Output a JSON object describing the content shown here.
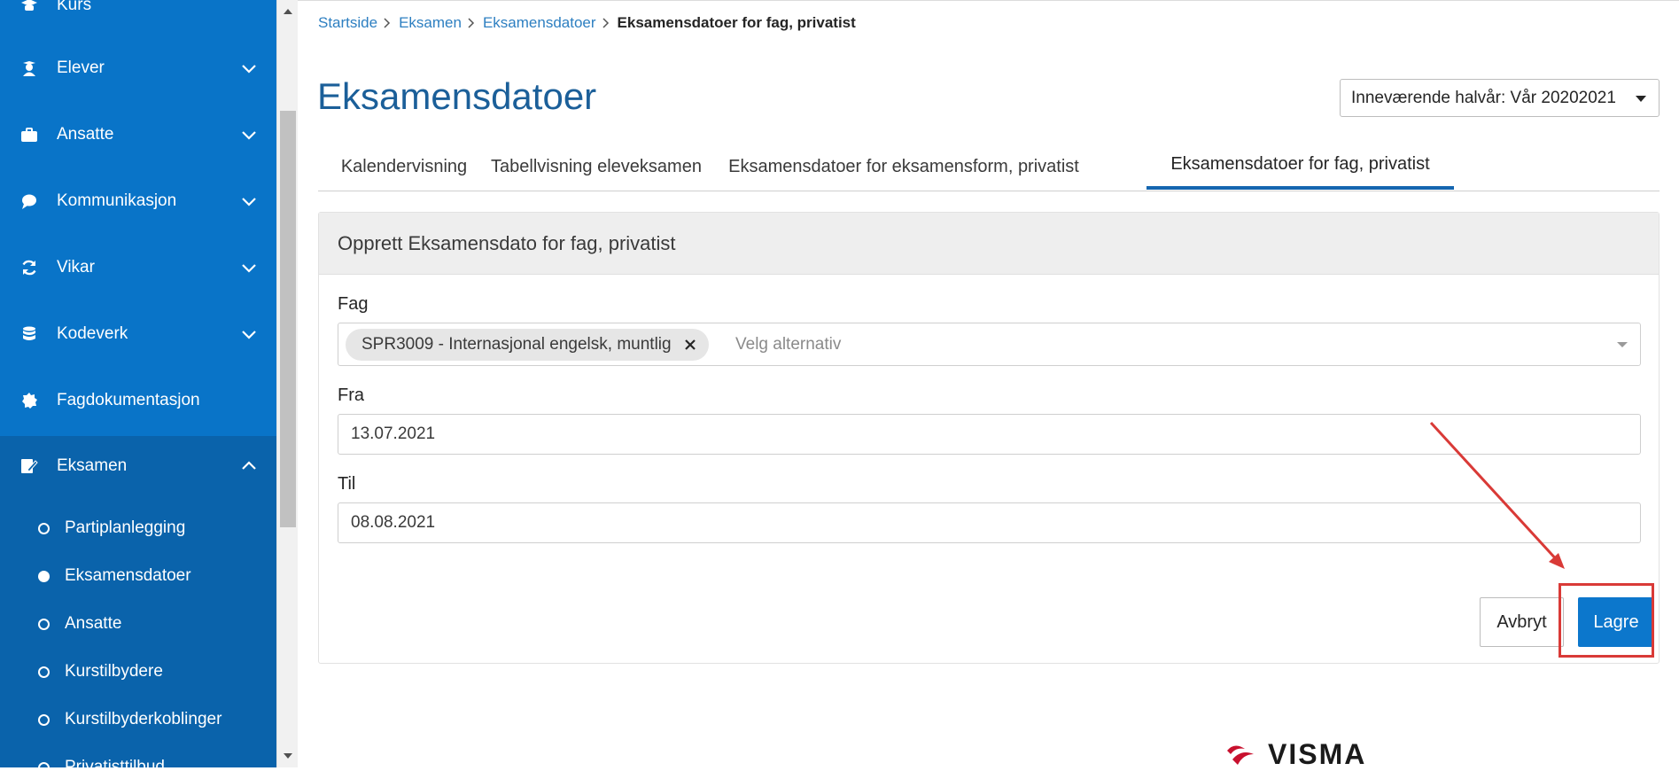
{
  "sidebar": {
    "items": [
      {
        "label": "Kurs",
        "icon": "graduation-cap-icon"
      },
      {
        "label": "Elever",
        "icon": "student-icon"
      },
      {
        "label": "Ansatte",
        "icon": "briefcase-icon"
      },
      {
        "label": "Kommunikasjon",
        "icon": "speech-bubble-icon"
      },
      {
        "label": "Vikar",
        "icon": "refresh-icon"
      },
      {
        "label": "Kodeverk",
        "icon": "database-icon"
      },
      {
        "label": "Fagdokumentasjon",
        "icon": "seal-icon"
      },
      {
        "label": "Eksamen",
        "icon": "edit-document-icon"
      }
    ],
    "subitems": [
      {
        "label": "Partiplanlegging",
        "active": false
      },
      {
        "label": "Eksamensdatoer",
        "active": true
      },
      {
        "label": "Ansatte",
        "active": false
      },
      {
        "label": "Kurstilbydere",
        "active": false
      },
      {
        "label": "Kurstilbyderkoblinger",
        "active": false
      },
      {
        "label": "Privatisttilbud",
        "active": false
      }
    ]
  },
  "breadcrumb": {
    "items": [
      "Startside",
      "Eksamen",
      "Eksamensdatoer"
    ],
    "current": "Eksamensdatoer for fag, privatist"
  },
  "page": {
    "title": "Eksamensdatoer",
    "term_select": "Inneværende halvår: Vår 20202021"
  },
  "tabs": [
    {
      "label": "Kalendervisning",
      "active": false
    },
    {
      "label": "Tabellvisning eleveksamen",
      "active": false
    },
    {
      "label": "Eksamensdatoer for eksamensform, privatist",
      "active": false
    },
    {
      "label": "Eksamensdatoer for fag, privatist",
      "active": true
    }
  ],
  "form": {
    "title": "Opprett Eksamensdato for fag, privatist",
    "fag_label": "Fag",
    "fag_selected": "SPR3009 - Internasjonal engelsk, muntlig",
    "fag_placeholder": "Velg alternativ",
    "fra_label": "Fra",
    "fra_value": "13.07.2021",
    "til_label": "Til",
    "til_value": "08.08.2021",
    "cancel_label": "Avbryt",
    "save_label": "Lagre"
  },
  "footer": {
    "logo_text": "VISMA"
  },
  "colors": {
    "sidebar_bg": "#0974c8",
    "sidebar_active_bg": "#0a63ab",
    "accent": "#0c77cc",
    "title": "#1b5f99",
    "annotation": "#d93a37"
  }
}
